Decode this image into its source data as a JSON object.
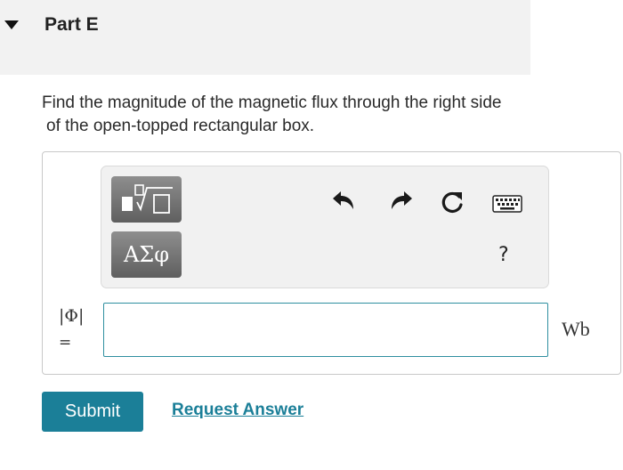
{
  "part": {
    "title": "Part E",
    "toggle_icon": "caret-down-icon"
  },
  "question": {
    "line1": "Find the magnitude of the magnetic flux through the right side",
    "line2": "of the open-topped rectangular box."
  },
  "toolbar": {
    "templates_icon": "math-templates-icon",
    "greek_label": "ΑΣφ",
    "undo_icon": "undo-icon",
    "redo_icon": "redo-icon",
    "reset_icon": "reset-icon",
    "keyboard_icon": "keyboard-icon",
    "help_label": "?"
  },
  "answer": {
    "variable": "|Φ|",
    "equals": "=",
    "value": "",
    "unit": "Wb"
  },
  "actions": {
    "submit_label": "Submit",
    "request_label": "Request Answer"
  },
  "colors": {
    "accent": "#1b7f98",
    "input_border": "#2f8fa0",
    "header_bg": "#f2f2f2"
  }
}
